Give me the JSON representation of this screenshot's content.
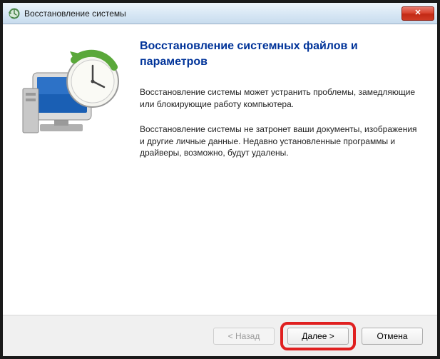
{
  "titlebar": {
    "title": "Восстановление системы"
  },
  "content": {
    "heading": "Восстановление системных файлов и параметров",
    "para1": "Восстановление системы может устранить проблемы, замедляющие или блокирующие работу компьютера.",
    "para2": "Восстановление системы не затронет ваши документы, изображения и другие личные данные. Недавно установленные программы и драйверы, возможно, будут удалены."
  },
  "footer": {
    "back": "< Назад",
    "next": "Далее >",
    "cancel": "Отмена"
  }
}
